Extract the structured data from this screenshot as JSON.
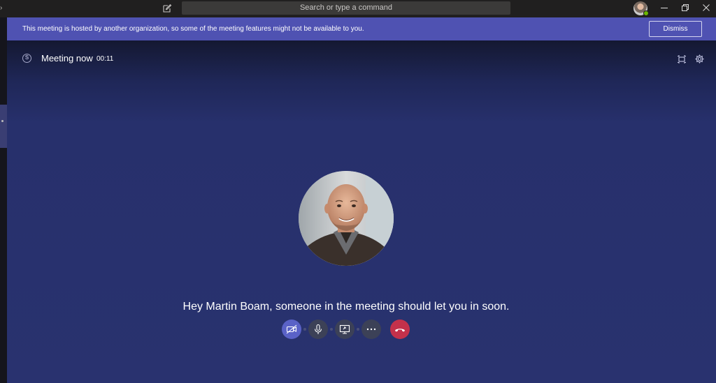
{
  "titlebar": {
    "search_placeholder": "Search or type a command",
    "icons": [
      "back-chevron-icon",
      "compose-icon",
      "avatar",
      "minimize-icon",
      "maximize-icon",
      "close-icon"
    ]
  },
  "banner": {
    "message": "This meeting is hosted by another organization, so some of the meeting features might not be available to you.",
    "dismiss_label": "Dismiss"
  },
  "meeting": {
    "title": "Meeting now",
    "timer": "00:11",
    "lobby_message": "Hey Martin Boam, someone in the meeting should let you in soon."
  },
  "controls": {
    "video": "video-off-icon",
    "mic": "microphone-icon",
    "share": "share-screen-icon",
    "more": "more-options-icon",
    "hangup": "hang-up-icon"
  },
  "colors": {
    "banner": "#4f52b2",
    "stage": "#29326f",
    "hangup": "#c4314b",
    "video_active": "#5a62c7",
    "presence": "#6bb700"
  }
}
